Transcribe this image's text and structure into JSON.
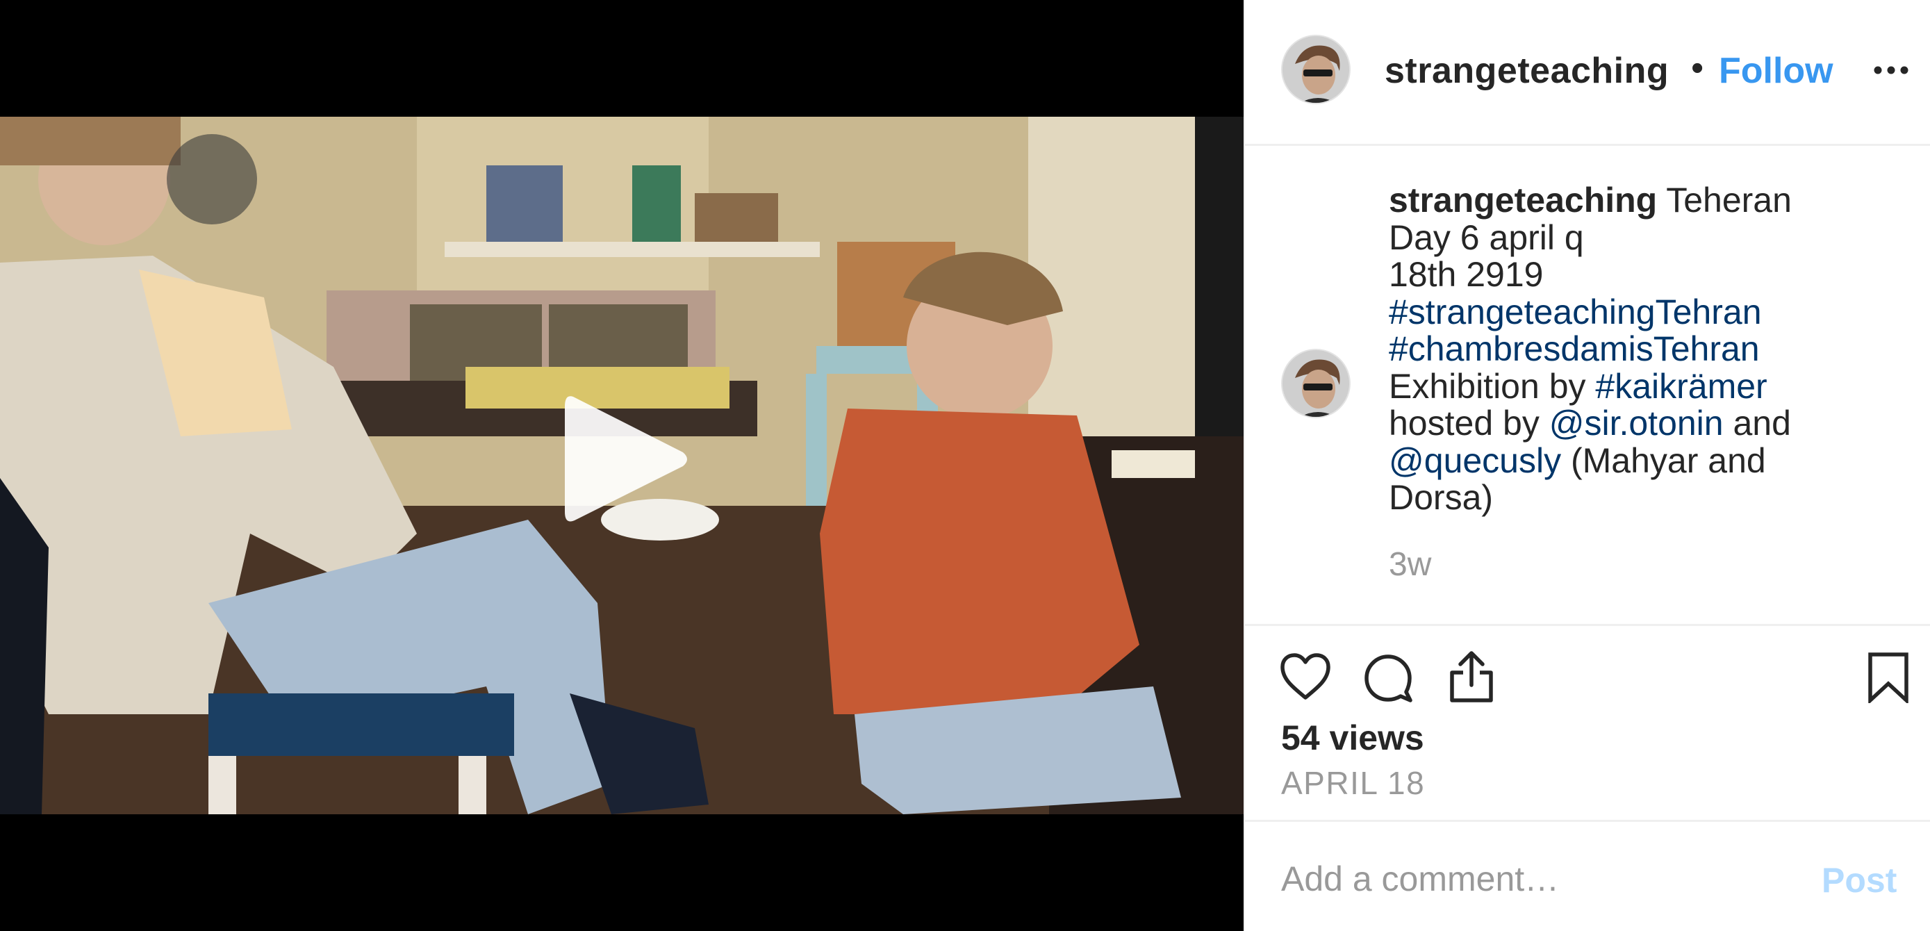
{
  "post": {
    "username": "strangeteaching",
    "header_separator": "•",
    "follow_label": "Follow",
    "caption": {
      "username": "strangeteaching",
      "line1": " Teheran",
      "line2": "Day 6 april q",
      "line3": "18th 2919",
      "hashtag1": "#strangeteachingTehran",
      "hashtag2": "#chambresdamisTehran",
      "exhibition_prefix": "Exhibition by ",
      "hashtag3": "#kaikrämer",
      "hosted_prefix": "hosted by ",
      "mention1": "@sir.otonin",
      "and_text": " and",
      "mention2": "@quecusly",
      "suffix": " (Mahyar and",
      "last": "Dorsa)"
    },
    "time_ago": "3w",
    "views": "54 views",
    "date": "APRIL 18",
    "comment_placeholder": "Add a comment…",
    "post_label": "Post"
  },
  "icons": {
    "like": "heart-icon",
    "comment": "comment-icon",
    "share": "share-icon",
    "save": "bookmark-icon",
    "more": "more-dots-icon",
    "play": "play-icon"
  },
  "colors": {
    "link": "#003569",
    "follow": "#3897f0",
    "post_disabled": "#b3dbff",
    "muted": "#999999"
  }
}
